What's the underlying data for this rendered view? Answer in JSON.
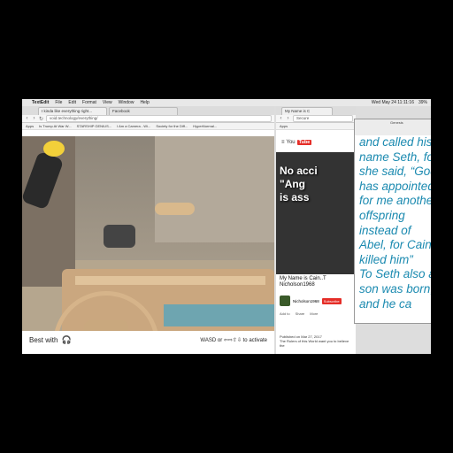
{
  "menubar": {
    "app": "TextEdit",
    "items": [
      "File",
      "Edit",
      "Format",
      "View",
      "Window",
      "Help"
    ],
    "clock": "Wed May 24 11:11:16",
    "battery": "39%"
  },
  "browser": {
    "tabs": [
      "I kinda like everything right...",
      "Facebook"
    ],
    "url": "void.technology/everything/",
    "bookmarks": [
      "Apps",
      "Is Trump At War W...",
      "STARSHIP GENIUS...",
      "I Am a Camera - Wi...",
      "Society for the Diff...",
      "HyperNormal..."
    ],
    "footer_left": "Best with",
    "footer_right": "WASD or ⇦⇨⇧⇩ to activate",
    "headphones_icon": "headphones-icon"
  },
  "youtube": {
    "tab": "My Name is C",
    "url": "Secure",
    "logo": "You",
    "logo_tube": "Tube",
    "video_lines": [
      "No acci",
      "\"Ang",
      "is ass"
    ],
    "title": "My Name is Cain..T Nicholson1968",
    "channel": "Nicholson1968",
    "subscribe": "Subscribe",
    "actions": [
      "Add to",
      "Share",
      "More"
    ],
    "published": "Published on Mar 27, 2017",
    "description": "The Rulers of this World want you to believe the"
  },
  "genesis": {
    "window_title": "Genesis",
    "lines": [
      "and called his",
      "name Seth, for",
      "she said, “God",
      "has appointed",
      "for me another",
      "offspring",
      "instead of",
      "Abel, for Cain",
      "killed him”",
      "To Seth also a",
      "son was born,",
      "and he ca"
    ]
  },
  "colors": {
    "genesis_text": "#1b8ab0",
    "youtube_red": "#e52d27"
  }
}
